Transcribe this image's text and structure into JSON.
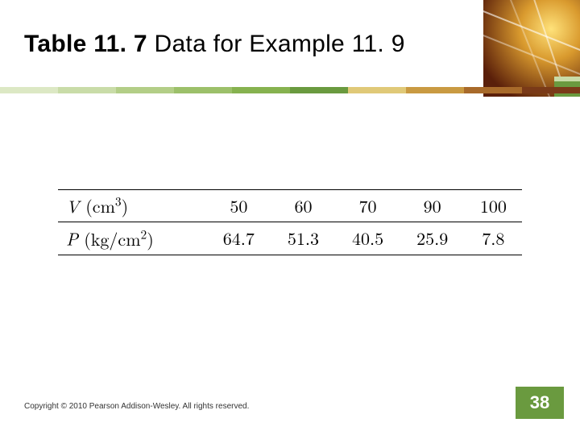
{
  "title_bold": "Table 11. 7",
  "title_plain": "  Data for Example 11. 9",
  "table": {
    "row1_label": "V (cm³)",
    "row1": [
      "50",
      "60",
      "70",
      "90",
      "100"
    ],
    "row2_label": "P (kg/cm²)",
    "row2": [
      "64.7",
      "51.3",
      "40.5",
      "25.9",
      "7.8"
    ]
  },
  "copyright": "Copyright © 2010 Pearson Addison-Wesley. All rights reserved.",
  "page_number": "38",
  "chart_data": {
    "type": "table",
    "title": "Table 11.7 Data for Example 11.9",
    "columns": [
      "V (cm^3)",
      "P (kg/cm^2)"
    ],
    "rows": [
      [
        50,
        64.7
      ],
      [
        60,
        51.3
      ],
      [
        70,
        40.5
      ],
      [
        90,
        25.9
      ],
      [
        100,
        7.8
      ]
    ]
  }
}
